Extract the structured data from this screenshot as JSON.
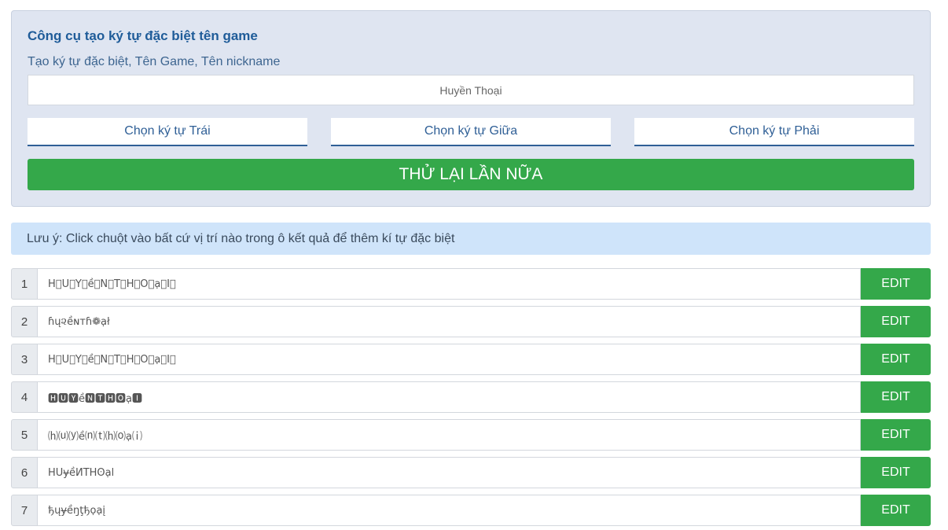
{
  "tool": {
    "title": "Công cụ tạo ký tự đặc biệt tên game",
    "subtitle": "Tạo ký tự đặc biệt, Tên Game, Tên nickname",
    "input_value": "Huyền Thoại",
    "select_left": "Chọn ký tự Trái",
    "select_middle": "Chọn ký tự Giữa",
    "select_right": "Chọn ký tự Phải",
    "retry_label": "THỬ LẠI LẦN NỮA"
  },
  "note": "Lưu ý: Click chuột vào bất cứ vị trí nào trong ô kết quả để thêm kí tự đặc biệt",
  "results": [
    {
      "num": "1",
      "text": "H⃞U⃞Y⃞ề⃞N⃞T⃞H⃞O⃞ạ⃞I⃞",
      "edit": "EDIT"
    },
    {
      "num": "2",
      "text": "ɦų૨ềɴтɦ❁ạł",
      "edit": "EDIT"
    },
    {
      "num": "3",
      "text": "H⃞U⃞Y⃞ề⃞N⃞T⃞H⃞O⃞ạ⃞I⃞",
      "edit": "EDIT"
    },
    {
      "num": "4",
      "text": "🅷🆄🆈ề🅽🆃🅷🅾ạ🅸",
      "edit": "EDIT"
    },
    {
      "num": "5",
      "text": "⒣⒰⒴ề⒩⒯⒣⒪ạ⒤",
      "edit": "EDIT"
    },
    {
      "num": "6",
      "text": "HUɏềИTHʘạl",
      "edit": "EDIT"
    },
    {
      "num": "7",
      "text": "ђųɏềŋţђọạį",
      "edit": "EDIT"
    }
  ],
  "colors": {
    "panel_bg": "#dfe5f1",
    "title": "#1f5c99",
    "button_green": "#34a84a",
    "note_bg": "#cfe4fa"
  }
}
